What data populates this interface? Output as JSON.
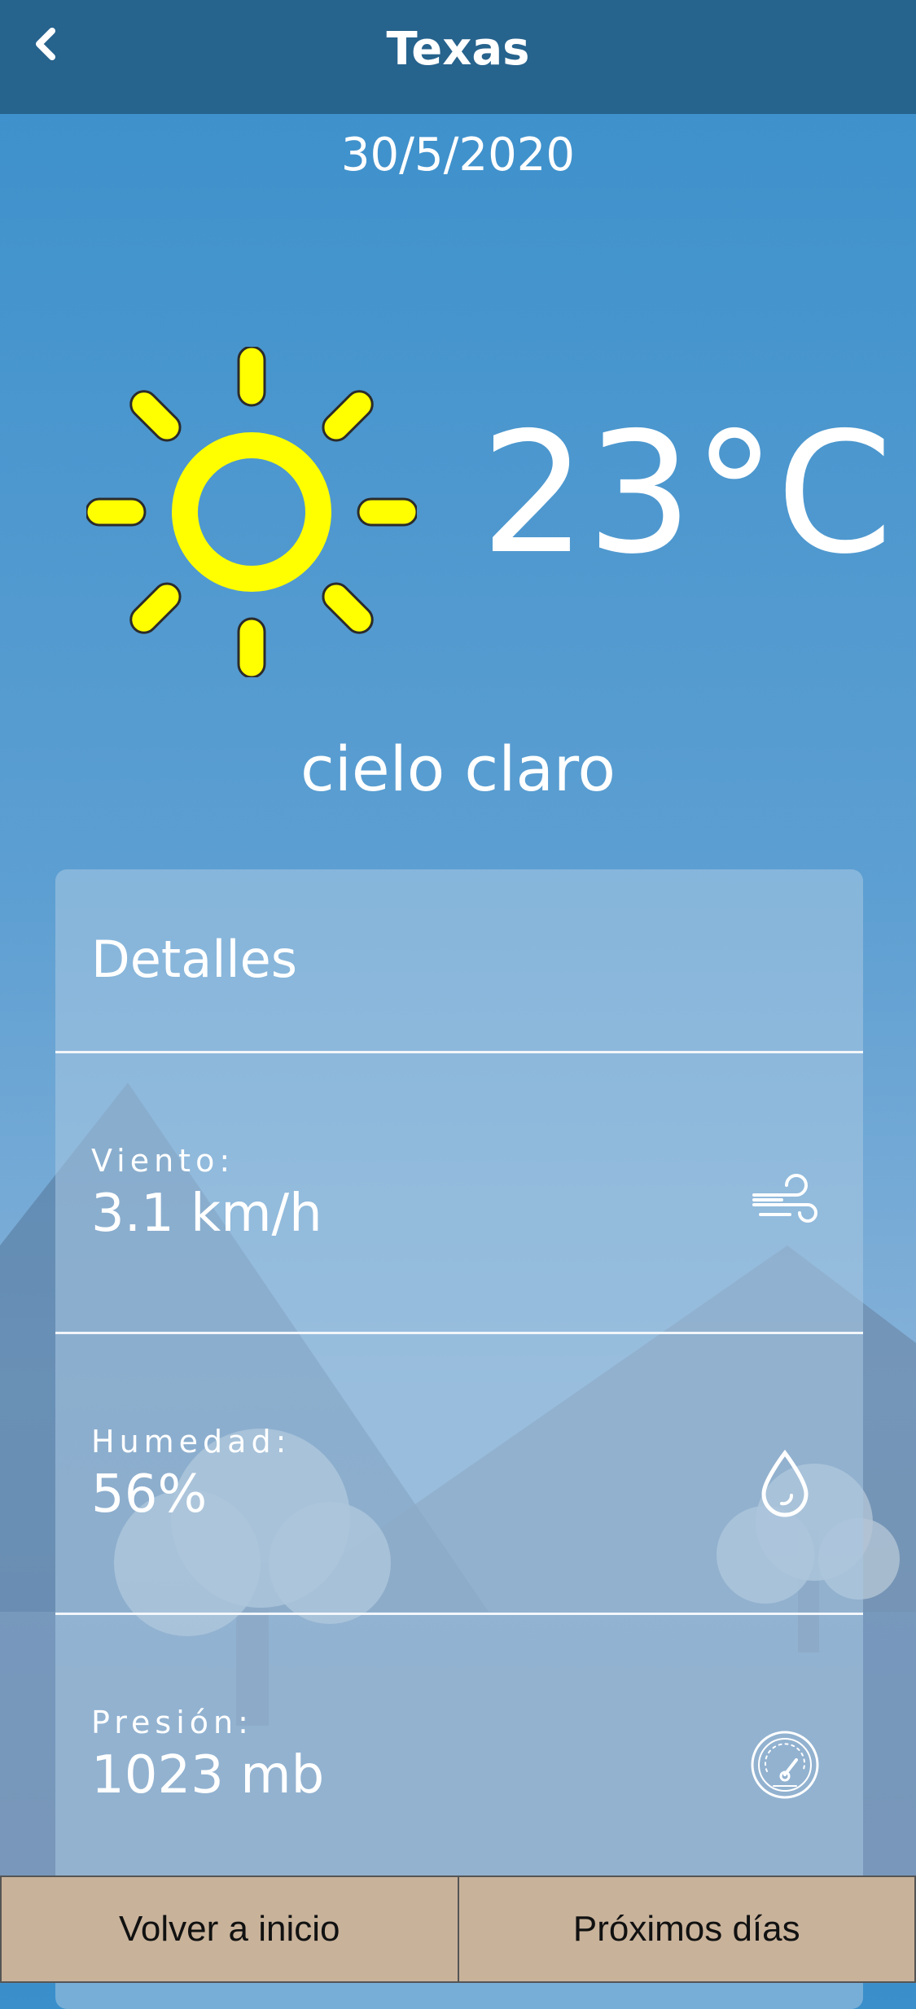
{
  "header": {
    "title": "Texas",
    "back_icon": "chevron-left-icon"
  },
  "date": "30/5/2020",
  "weather": {
    "icon": "sun-icon",
    "temperature": "23°C",
    "condition": "cielo claro"
  },
  "details": {
    "title": "Detalles",
    "items": [
      {
        "label": "Viento:",
        "value": "3.1 km/h",
        "icon": "wind-icon"
      },
      {
        "label": "Humedad:",
        "value": "56%",
        "icon": "water-drop-icon"
      },
      {
        "label": "Presión:",
        "value": "1023 mb",
        "icon": "gauge-icon"
      }
    ]
  },
  "footer": {
    "home_label": "Volver a inicio",
    "next_days_label": "Próximos días"
  },
  "colors": {
    "header_bg": "#26638d",
    "sun": "#ffff00",
    "button_bg": "#c8b29a"
  }
}
